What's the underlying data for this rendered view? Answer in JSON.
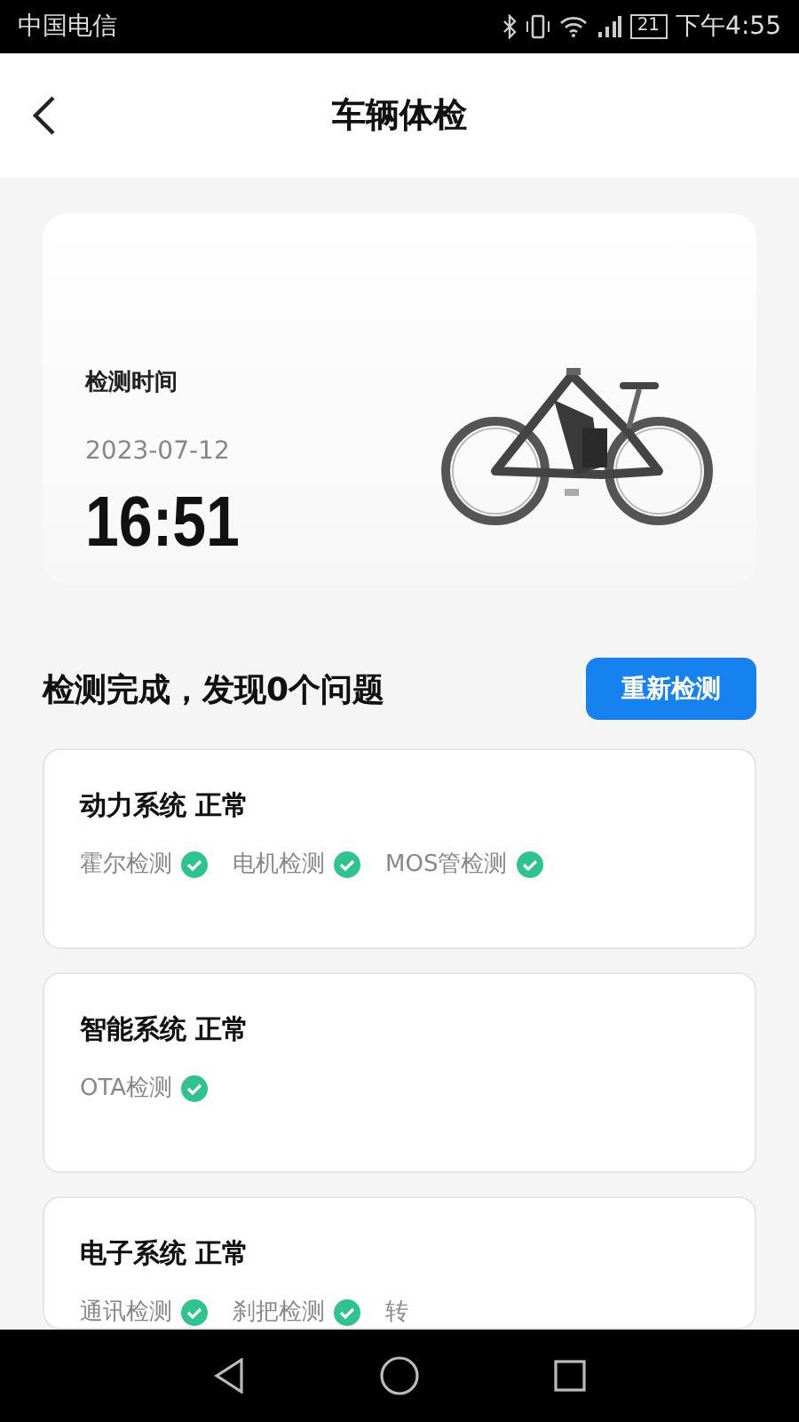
{
  "status_bar": {
    "carrier": "中国电信",
    "battery": "21",
    "time": "下午4:55"
  },
  "header": {
    "back": true,
    "title": "车辆体检"
  },
  "hero": {
    "label": "检测时间",
    "date": "2023-07-12",
    "time": "16:51"
  },
  "summary": {
    "text": "检测完成，发现0个问题",
    "button": "重新检测"
  },
  "systems": [
    {
      "name": "动力系统 正常",
      "checks": [
        {
          "label": "霍尔检测",
          "ok": true
        },
        {
          "label": "电机检测",
          "ok": true
        },
        {
          "label": "MOS管检测",
          "ok": true
        }
      ]
    },
    {
      "name": "智能系统 正常",
      "checks": [
        {
          "label": "OTA检测",
          "ok": true
        }
      ]
    },
    {
      "name": "电子系统 正常",
      "checks": [
        {
          "label": "通讯检测",
          "ok": true
        },
        {
          "label": "刹把检测",
          "ok": true
        },
        {
          "label": "转",
          "ok": false
        }
      ]
    }
  ]
}
